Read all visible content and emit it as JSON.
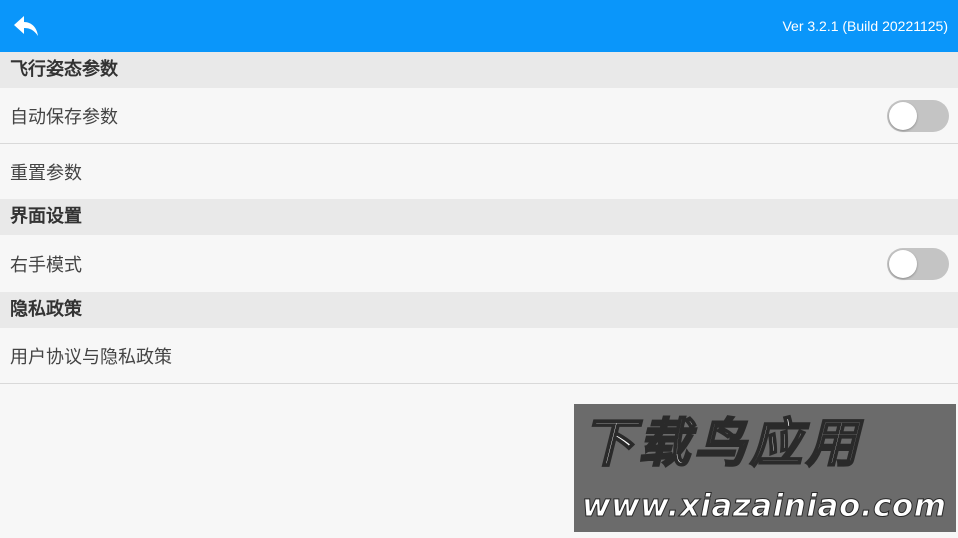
{
  "header": {
    "back_icon": "back-arrow-icon",
    "version": "Ver 3.2.1 (Build 20221125)",
    "background": "#0a96fa"
  },
  "sections": [
    {
      "title": "飞行姿态参数",
      "items": [
        {
          "label": "自动保存参数",
          "toggle": false
        },
        {
          "label": "重置参数"
        }
      ]
    },
    {
      "title": "界面设置",
      "items": [
        {
          "label": "右手模式",
          "toggle": false
        }
      ]
    },
    {
      "title": "隐私政策",
      "items": [
        {
          "label": "用户协议与隐私政策"
        }
      ]
    }
  ],
  "watermark": {
    "title": "下载鸟应用",
    "url": "www.xiazainiao.com"
  }
}
